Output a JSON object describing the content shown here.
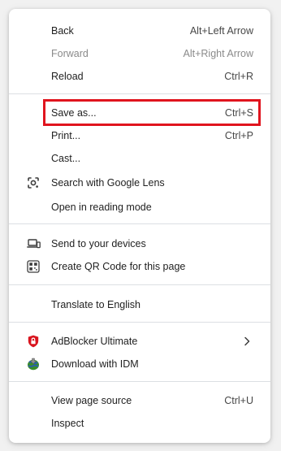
{
  "menu": {
    "back": {
      "label": "Back",
      "shortcut": "Alt+Left Arrow"
    },
    "forward": {
      "label": "Forward",
      "shortcut": "Alt+Right Arrow"
    },
    "reload": {
      "label": "Reload",
      "shortcut": "Ctrl+R"
    },
    "save_as": {
      "label": "Save as...",
      "shortcut": "Ctrl+S"
    },
    "print": {
      "label": "Print...",
      "shortcut": "Ctrl+P"
    },
    "cast": {
      "label": "Cast..."
    },
    "search_lens": {
      "label": "Search with Google Lens",
      "icon": "google-lens-icon"
    },
    "reading_mode": {
      "label": "Open in reading mode"
    },
    "send_devices": {
      "label": "Send to your devices",
      "icon": "devices-icon"
    },
    "qr_code": {
      "label": "Create QR Code for this page",
      "icon": "qr-code-icon"
    },
    "translate": {
      "label": "Translate to English"
    },
    "adblocker": {
      "label": "AdBlocker Ultimate",
      "icon": "adblocker-shield-icon"
    },
    "idm": {
      "label": "Download with IDM",
      "icon": "idm-globe-icon"
    },
    "view_source": {
      "label": "View page source",
      "shortcut": "Ctrl+U"
    },
    "inspect": {
      "label": "Inspect"
    }
  },
  "colors": {
    "highlight_border": "#e0141e",
    "disabled_text": "#8a8a8a",
    "divider": "#dcdfe3"
  }
}
